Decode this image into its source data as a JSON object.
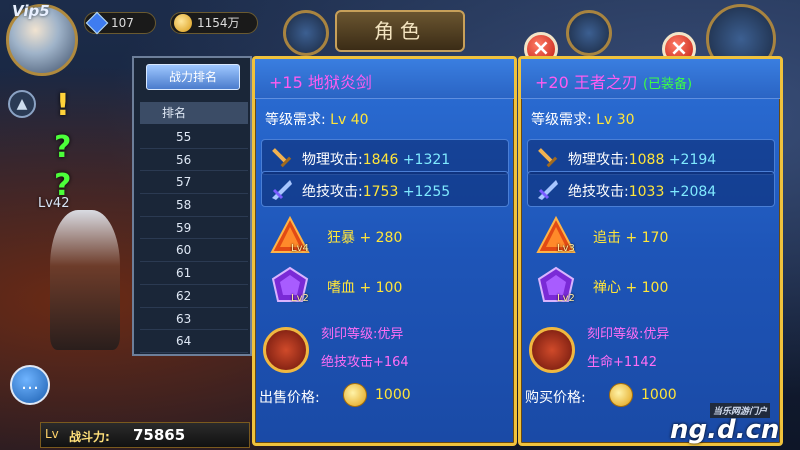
{
  "hud": {
    "vip": "Vip5",
    "gems": "107",
    "gold": "1154万",
    "title": "角色"
  },
  "left": {
    "char_level": "Lv42",
    "power_level": "Lv",
    "power_label": "战斗力:",
    "power_value": "75865"
  },
  "ranking": {
    "tab_label": "战力排名",
    "column_header": "排名",
    "rows": [
      "55",
      "56",
      "57",
      "58",
      "59",
      "60",
      "61",
      "62",
      "63",
      "64"
    ]
  },
  "cards": [
    {
      "name": "+15 地狱炎剑",
      "equipped": "",
      "req_label": "等级需求:",
      "req_value": "Lv 40",
      "stat1_label": "物理攻击:",
      "stat1_base": "1846",
      "stat1_bonus": "+1321",
      "stat2_label": "绝技攻击:",
      "stat2_base": "1753",
      "stat2_bonus": "+1255",
      "gem1_text": "狂暴 + 280",
      "gem1_level": "Lv4",
      "gem2_text": "嗜血 + 100",
      "gem2_level": "Lv2",
      "engrave_line1": "刻印等级:优异",
      "engrave_line2": "绝技攻击+164",
      "price_label": "出售价格:",
      "price_value": "1000"
    },
    {
      "name": "+20 王者之刃",
      "equipped": "(已装备)",
      "req_label": "等级需求:",
      "req_value": "Lv 30",
      "stat1_label": "物理攻击:",
      "stat1_base": "1088",
      "stat1_bonus": "+2194",
      "stat2_label": "绝技攻击:",
      "stat2_base": "1033",
      "stat2_bonus": "+2084",
      "gem1_text": "追击 + 170",
      "gem1_level": "Lv3",
      "gem2_text": "禅心 + 100",
      "gem2_level": "Lv2",
      "engrave_line1": "刻印等级:优异",
      "engrave_line2": "生命+1142",
      "price_label": "购买价格:",
      "price_value": "1000"
    }
  ],
  "watermark": {
    "small": "当乐网游门户",
    "big": "ng.d.cn"
  },
  "colors": {
    "card_border": "#f0c23c",
    "card_bg": "#2c6fd6",
    "item_name": "#ff5cf0",
    "stat_base": "#ffe53a",
    "stat_bonus": "#7fe9ff"
  }
}
